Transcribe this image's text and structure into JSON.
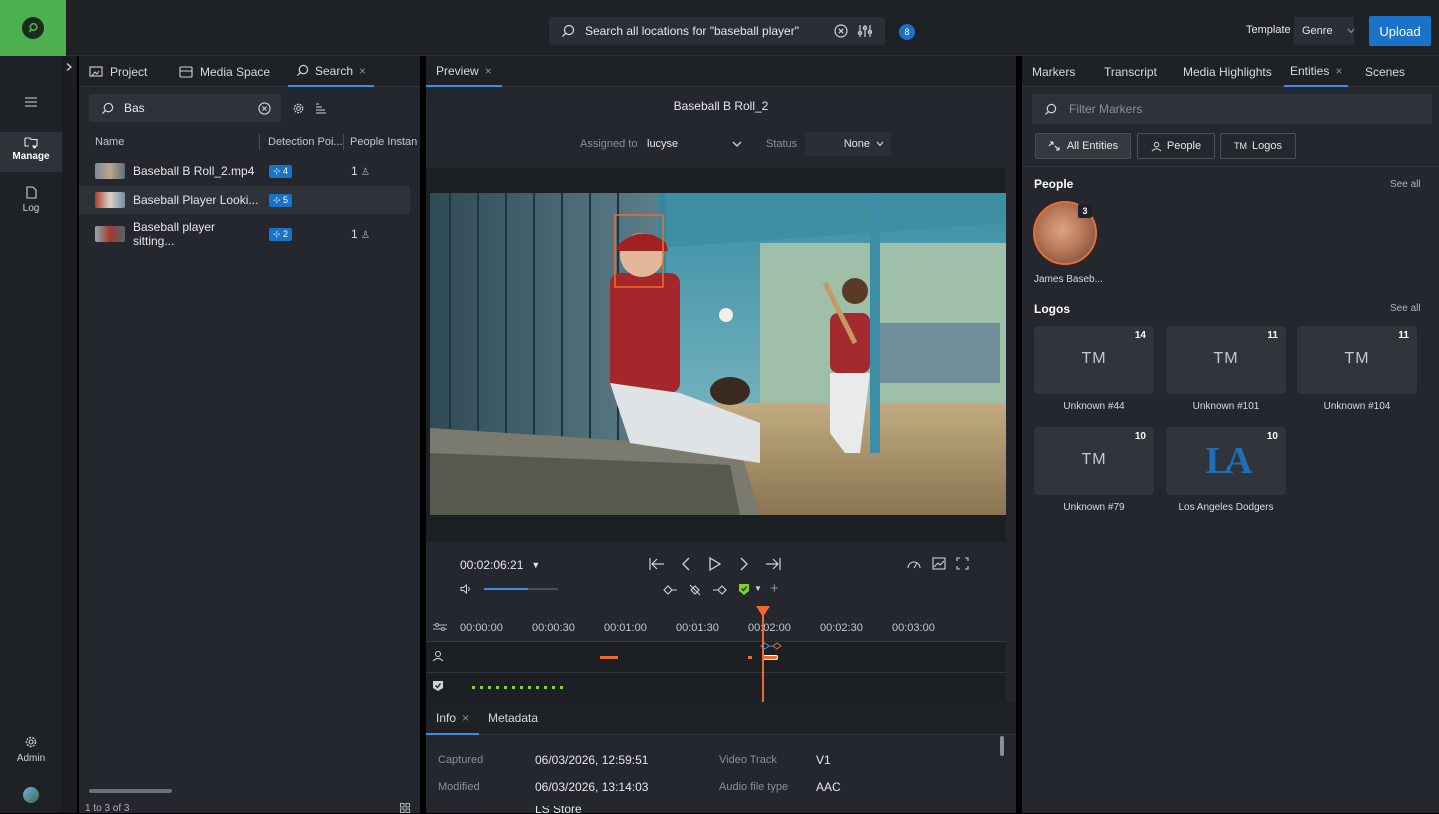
{
  "header": {
    "search_text": "Search all locations for \"baseball player\"",
    "notification_count": "8",
    "template_label": "Template",
    "template_value": "Genre",
    "upload_label": "Upload"
  },
  "rail": {
    "manage_label": "Manage",
    "log_label": "Log",
    "admin_label": "Admin"
  },
  "left_panel": {
    "tabs": [
      {
        "label": "Project"
      },
      {
        "label": "Media Space"
      },
      {
        "label": "Search"
      }
    ],
    "search_value": "Bas",
    "columns": [
      "Name",
      "Detection Poi...",
      "People Instan"
    ],
    "rows": [
      {
        "name": "Baseball B Roll_2.mp4",
        "detections": "4",
        "people": "1"
      },
      {
        "name": "Baseball Player Looki...",
        "detections": "5",
        "people": ""
      },
      {
        "name": "Baseball player sitting...",
        "detections": "2",
        "people": "1"
      }
    ],
    "footer": "1 to 3 of 3"
  },
  "preview": {
    "tab_label": "Preview",
    "title": "Baseball B Roll_2",
    "assigned_label": "Assigned to",
    "assigned_value": "lucyse",
    "status_label": "Status",
    "status_value": "None",
    "timecode": "00:02:06:21",
    "volume_level": 0.6,
    "ticks": [
      "00:00:00",
      "00:00:30",
      "00:01:00",
      "00:01:30",
      "00:02:00",
      "00:02:30",
      "00:03:00"
    ]
  },
  "info": {
    "tabs": [
      {
        "label": "Info"
      },
      {
        "label": "Metadata"
      }
    ],
    "fields": [
      {
        "label": "Captured",
        "value": "06/03/2026, 12:59:51"
      },
      {
        "label": "Modified",
        "value": "06/03/2026, 13:14:03"
      }
    ],
    "fields_right": [
      {
        "label": "Video Track",
        "value": "V1"
      },
      {
        "label": "Audio file type",
        "value": "AAC"
      }
    ],
    "partial_value": "LS Store"
  },
  "right_panel": {
    "tabs": [
      {
        "label": "Markers"
      },
      {
        "label": "Transcript"
      },
      {
        "label": "Media Highlights"
      },
      {
        "label": "Entities"
      },
      {
        "label": "Scenes"
      }
    ],
    "filter_placeholder": "Filter Markers",
    "filters": [
      {
        "label": "All Entities"
      },
      {
        "label": "People"
      },
      {
        "label": "Logos"
      }
    ],
    "people_title": "People",
    "see_all": "See all",
    "people": [
      {
        "name": "James Baseb...",
        "count": "3"
      }
    ],
    "logos_title": "Logos",
    "logos": [
      {
        "name": "Unknown #44",
        "count": "14",
        "mark": "TM"
      },
      {
        "name": "Unknown #101",
        "count": "11",
        "mark": "TM"
      },
      {
        "name": "Unknown #104",
        "count": "11",
        "mark": "TM"
      },
      {
        "name": "Unknown #79",
        "count": "10",
        "mark": "TM"
      },
      {
        "name": "Los Angeles Dodgers",
        "count": "10",
        "mark": "LA"
      }
    ]
  },
  "colors": {
    "accent": "#1a73c8",
    "brand_green": "#4caf50",
    "marker_orange": "#f26b2a",
    "marker_green": "#7ed321",
    "dodgers_blue": "#1e6fb8"
  }
}
